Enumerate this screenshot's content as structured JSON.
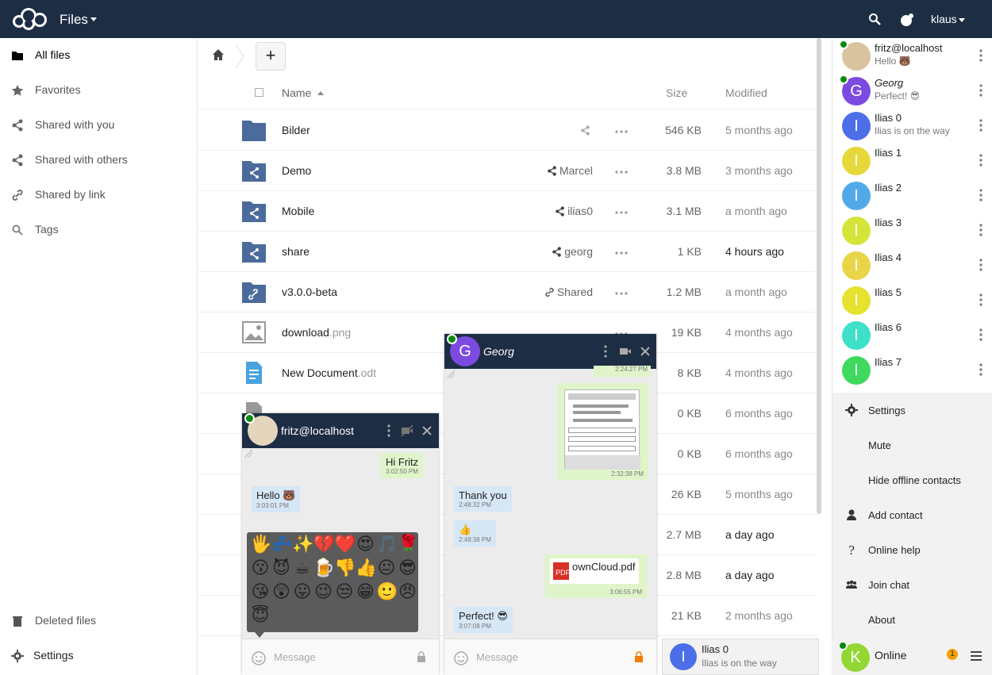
{
  "header": {
    "app_name": "Files",
    "user": "klaus"
  },
  "sidebar": {
    "items": [
      {
        "label": "All files"
      },
      {
        "label": "Favorites"
      },
      {
        "label": "Shared with you"
      },
      {
        "label": "Shared with others"
      },
      {
        "label": "Shared by link"
      },
      {
        "label": "Tags"
      }
    ],
    "deleted": "Deleted files",
    "settings": "Settings"
  },
  "files": {
    "columns": {
      "name": "Name",
      "size": "Size",
      "modified": "Modified"
    },
    "rows": [
      {
        "name": "Bilder",
        "ext": "",
        "share": "",
        "size": "546 KB",
        "modified": "5 months ago"
      },
      {
        "name": "Demo",
        "ext": "",
        "share": "Marcel",
        "size": "3.8 MB",
        "modified": "3 months ago"
      },
      {
        "name": "Mobile",
        "ext": "",
        "share": "ilias0",
        "size": "3.1 MB",
        "modified": "a month ago"
      },
      {
        "name": "share",
        "ext": "",
        "share": "georg",
        "size": "1 KB",
        "modified": "4 hours ago"
      },
      {
        "name": "v3.0.0-beta",
        "ext": "",
        "share": "Shared",
        "size": "1.2 MB",
        "modified": "a month ago"
      },
      {
        "name": "download",
        "ext": ".png",
        "share": "",
        "size": "19 KB",
        "modified": "4 months ago"
      },
      {
        "name": "New Document",
        "ext": ".odt",
        "share": "",
        "size": "8 KB",
        "modified": "4 months ago"
      },
      {
        "name": "",
        "ext": "",
        "share": "",
        "size": "0 KB",
        "modified": "6 months ago"
      },
      {
        "name": "",
        "ext": "",
        "share": "",
        "size": "0 KB",
        "modified": "6 months ago"
      },
      {
        "name": "",
        "ext": "",
        "share": "",
        "size": "26 KB",
        "modified": "5 months ago"
      },
      {
        "name": "",
        "ext": "",
        "share": "",
        "size": "2.7 MB",
        "modified": "a day ago"
      },
      {
        "name": "",
        "ext": "",
        "share": "",
        "size": "2.8 MB",
        "modified": "a day ago"
      },
      {
        "name": "",
        "ext": "",
        "share": "",
        "size": "21 KB",
        "modified": "2 months ago"
      }
    ]
  },
  "roster": {
    "contacts": [
      {
        "name": "fritz@localhost",
        "status": "Hello 🐻",
        "initial": "",
        "color": "#d9c3a0"
      },
      {
        "name": "Georg",
        "status": "Perfect! 😎",
        "initial": "G",
        "color": "#7b4be0"
      },
      {
        "name": "Ilias 0",
        "status": "Ilias is on the way",
        "initial": "I",
        "color": "#4c6ee8"
      },
      {
        "name": "Ilias 1",
        "status": "",
        "initial": "I",
        "color": "#e7d83a"
      },
      {
        "name": "Ilias 2",
        "status": "",
        "initial": "I",
        "color": "#52a9ea"
      },
      {
        "name": "Ilias 3",
        "status": "",
        "initial": "I",
        "color": "#d6e43a"
      },
      {
        "name": "Ilias 4",
        "status": "",
        "initial": "I",
        "color": "#e9d44a"
      },
      {
        "name": "Ilias 5",
        "status": "",
        "initial": "I",
        "color": "#e6e22e"
      },
      {
        "name": "Ilias 6",
        "status": "",
        "initial": "I",
        "color": "#3ee0c8"
      },
      {
        "name": "Ilias 7",
        "status": "",
        "initial": "I",
        "color": "#3ed95e"
      }
    ]
  },
  "menu": {
    "items": [
      "Settings",
      "Mute",
      "Hide offline contacts",
      "Add contact",
      "Online help",
      "Join chat",
      "About"
    ]
  },
  "me": {
    "initial": "K",
    "status": "Online",
    "badge": "1"
  },
  "chat_fritz": {
    "title": "fritz@localhost",
    "messages": [
      {
        "text": "Hi Fritz",
        "time": "3:02:50 PM"
      },
      {
        "text": "Hello 🐻",
        "time": "3:03:01 PM"
      }
    ],
    "emojis": [
      "🖐",
      "💤",
      "✨",
      "💔",
      "❤️",
      "😍",
      "🎵",
      "🌹",
      "😗",
      "😈",
      "☕",
      "🍺",
      "👎",
      "👍",
      "😐",
      "😎",
      "😘",
      "😲",
      "😛",
      "😉",
      "😒",
      "😁",
      "🙂",
      "😠",
      "😇"
    ],
    "placeholder": "Message"
  },
  "chat_georg": {
    "title": "Georg",
    "messages": [
      {
        "text": "",
        "time": "2:24:27 PM"
      },
      {
        "text": "",
        "time": "2:32:38 PM"
      },
      {
        "text": "Thank you",
        "time": "2:48:32 PM"
      },
      {
        "text": "👍",
        "time": "2:48:38 PM"
      },
      {
        "text": "ownCloud.pdf",
        "time": "3:06:55 PM"
      },
      {
        "text": "Perfect! 😎",
        "time": "3:07:08 PM"
      }
    ],
    "placeholder": "Message"
  },
  "mini_chat": {
    "initial": "I",
    "name": "Ilias 0",
    "status": "Ilias is on the way"
  }
}
